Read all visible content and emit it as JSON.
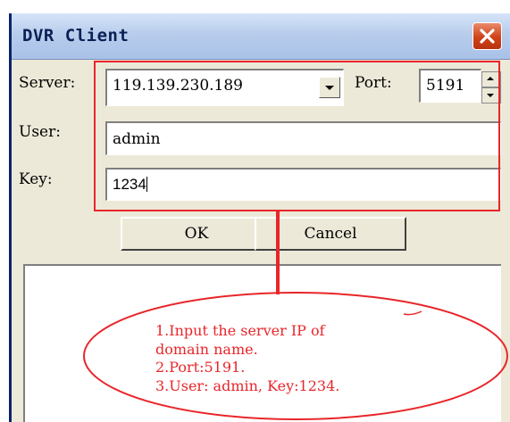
{
  "window": {
    "title": "DVR Client"
  },
  "form": {
    "server_label": "Server:",
    "server_value": "119.139.230.189",
    "port_label": "Port:",
    "port_value": "5191",
    "user_label": "User:",
    "user_value": "admin",
    "key_label": "Key:",
    "key_value": "1234"
  },
  "buttons": {
    "ok": "OK",
    "cancel": "Cancel"
  },
  "annotation": {
    "color": "#e8262a",
    "lines": [
      "1.Input the server IP of",
      "domain name.",
      "2.Port:5191.",
      "3.User: admin, Key:1234."
    ]
  }
}
